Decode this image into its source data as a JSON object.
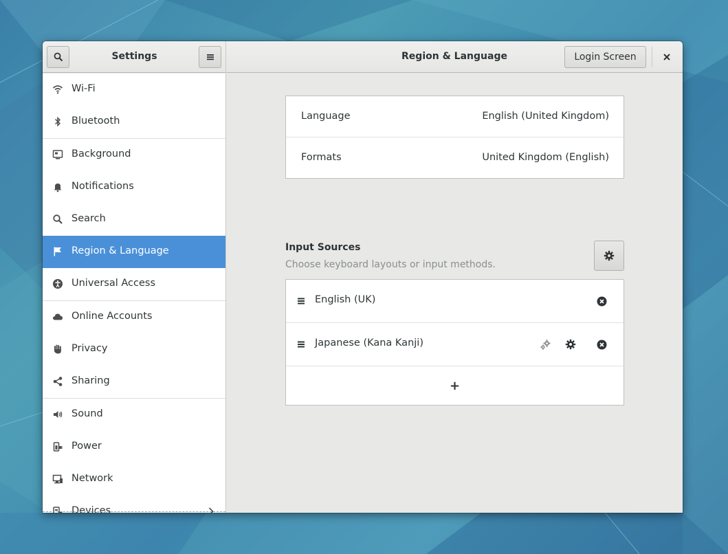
{
  "window": {
    "sidebar_title": "Settings",
    "main_title": "Region & Language",
    "login_screen_label": "Login Screen"
  },
  "sidebar": {
    "items": [
      {
        "label": "Wi-Fi",
        "icon": "wifi-icon"
      },
      {
        "label": "Bluetooth",
        "icon": "bluetooth-icon"
      },
      {
        "label": "Background",
        "icon": "background-icon"
      },
      {
        "label": "Notifications",
        "icon": "bell-icon"
      },
      {
        "label": "Search",
        "icon": "search-icon"
      },
      {
        "label": "Region & Language",
        "icon": "flag-icon",
        "active": true
      },
      {
        "label": "Universal Access",
        "icon": "accessibility-icon"
      },
      {
        "label": "Online Accounts",
        "icon": "cloud-icon"
      },
      {
        "label": "Privacy",
        "icon": "hand-icon"
      },
      {
        "label": "Sharing",
        "icon": "share-icon"
      },
      {
        "label": "Sound",
        "icon": "speaker-icon"
      },
      {
        "label": "Power",
        "icon": "power-plug-icon"
      },
      {
        "label": "Network",
        "icon": "network-icon"
      },
      {
        "label": "Devices",
        "icon": "devices-icon"
      }
    ]
  },
  "region": {
    "language_label": "Language",
    "language_value": "English (United Kingdom)",
    "formats_label": "Formats",
    "formats_value": "United Kingdom (English)"
  },
  "input_sources": {
    "title": "Input Sources",
    "subtitle": "Choose keyboard layouts or input methods.",
    "items": [
      {
        "label": "English (UK)"
      },
      {
        "label": "Japanese (Kana Kanji)"
      }
    ],
    "add_label": "+"
  },
  "colors": {
    "accent": "#4a90d9",
    "window_bg": "#e8e8e7"
  }
}
